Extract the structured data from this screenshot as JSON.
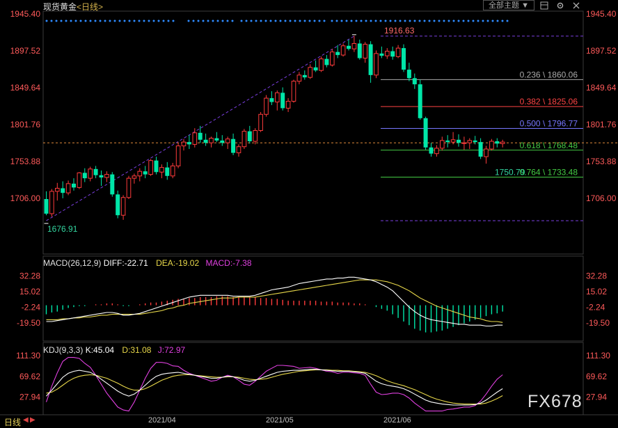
{
  "header": {
    "instrument": "现货黄金",
    "period": "<日线>",
    "theme_button": "全部主题",
    "theme_arrow": "▼"
  },
  "icons": {
    "layout": "layout-icon",
    "settings": "gear-icon",
    "close": "close-icon"
  },
  "colors": {
    "up": "#ff3b3b",
    "down": "#00e6a8",
    "bg": "#000000",
    "axis_text": "#ff5a5a",
    "dif": "#ffffff",
    "dea": "#e8d84a",
    "kdj_k": "#ffffff",
    "kdj_d": "#e8d84a",
    "kdj_j": "#e040e0",
    "fib_red": "#ff4444",
    "fib_blue": "#7777ff",
    "fib_green": "#44cc44",
    "fib_gray": "#aaaaaa"
  },
  "chart_data": [
    {
      "type": "candlestick",
      "title": "现货黄金",
      "period": "日线",
      "y_ticks": [
        "1945.40",
        "1897.52",
        "1849.64",
        "1801.76",
        "1753.88",
        "1706.00"
      ],
      "ylim": [
        1658,
        1945.4
      ],
      "x_ticks": [
        "2021/04",
        "2021/05",
        "2021/06"
      ],
      "annotations": {
        "low_label": "1676.91",
        "high_label": "1916.63",
        "swing_low_label": "1750.79"
      },
      "current_price": 1778,
      "fibonacci": [
        {
          "label": "0.236 \\ 1860.06",
          "value": 1860.06,
          "color": "gray"
        },
        {
          "label": "0.382 \\ 1825.06",
          "value": 1825.06,
          "color": "red"
        },
        {
          "label": "0.500 \\ 1796.77",
          "value": 1796.77,
          "color": "blue"
        },
        {
          "label": "0.618 \\ 1768.48",
          "value": 1768.48,
          "color": "green"
        },
        {
          "label": "0.764 \\ 1733.48",
          "value": 1733.48,
          "color": "green"
        }
      ],
      "fib_top": 1916.63,
      "fib_bottom": 1676.91,
      "ohlc": [
        [
          1705,
          1715,
          1684,
          1686
        ],
        [
          1686,
          1718,
          1682,
          1715
        ],
        [
          1715,
          1726,
          1703,
          1719
        ],
        [
          1719,
          1728,
          1706,
          1713
        ],
        [
          1713,
          1729,
          1710,
          1725
        ],
        [
          1725,
          1732,
          1716,
          1720
        ],
        [
          1720,
          1740,
          1718,
          1739
        ],
        [
          1739,
          1745,
          1727,
          1732
        ],
        [
          1732,
          1747,
          1728,
          1744
        ],
        [
          1744,
          1748,
          1732,
          1736
        ],
        [
          1736,
          1742,
          1722,
          1733
        ],
        [
          1733,
          1741,
          1727,
          1737
        ],
        [
          1737,
          1740,
          1708,
          1711
        ],
        [
          1711,
          1716,
          1680,
          1684
        ],
        [
          1684,
          1710,
          1678,
          1707
        ],
        [
          1707,
          1735,
          1705,
          1732
        ],
        [
          1732,
          1738,
          1725,
          1735
        ],
        [
          1735,
          1745,
          1728,
          1741
        ],
        [
          1741,
          1748,
          1732,
          1737
        ],
        [
          1737,
          1757,
          1735,
          1755
        ],
        [
          1755,
          1760,
          1737,
          1740
        ],
        [
          1740,
          1750,
          1732,
          1746
        ],
        [
          1746,
          1753,
          1730,
          1735
        ],
        [
          1735,
          1752,
          1732,
          1748
        ],
        [
          1748,
          1778,
          1745,
          1774
        ],
        [
          1774,
          1783,
          1768,
          1779
        ],
        [
          1779,
          1788,
          1770,
          1776
        ],
        [
          1776,
          1797,
          1772,
          1791
        ],
        [
          1791,
          1800,
          1778,
          1782
        ],
        [
          1782,
          1790,
          1774,
          1778
        ],
        [
          1778,
          1786,
          1772,
          1784
        ],
        [
          1784,
          1792,
          1779,
          1781
        ],
        [
          1781,
          1788,
          1774,
          1778
        ],
        [
          1778,
          1786,
          1770,
          1783
        ],
        [
          1783,
          1790,
          1762,
          1765
        ],
        [
          1765,
          1776,
          1760,
          1773
        ],
        [
          1773,
          1796,
          1770,
          1793
        ],
        [
          1793,
          1800,
          1777,
          1780
        ],
        [
          1780,
          1797,
          1776,
          1794
        ],
        [
          1794,
          1818,
          1792,
          1815
        ],
        [
          1815,
          1840,
          1812,
          1836
        ],
        [
          1836,
          1845,
          1827,
          1831
        ],
        [
          1831,
          1846,
          1820,
          1843
        ],
        [
          1843,
          1850,
          1820,
          1823
        ],
        [
          1823,
          1836,
          1818,
          1832
        ],
        [
          1832,
          1860,
          1830,
          1858
        ],
        [
          1858,
          1870,
          1854,
          1866
        ],
        [
          1866,
          1872,
          1860,
          1863
        ],
        [
          1863,
          1880,
          1861,
          1876
        ],
        [
          1876,
          1885,
          1870,
          1872
        ],
        [
          1872,
          1890,
          1870,
          1887
        ],
        [
          1887,
          1892,
          1876,
          1879
        ],
        [
          1879,
          1900,
          1877,
          1896
        ],
        [
          1896,
          1905,
          1888,
          1892
        ],
        [
          1892,
          1907,
          1890,
          1904
        ],
        [
          1904,
          1912,
          1898,
          1900
        ],
        [
          1900,
          1917,
          1896,
          1907
        ],
        [
          1907,
          1912,
          1886,
          1888
        ],
        [
          1888,
          1909,
          1882,
          1906
        ],
        [
          1906,
          1910,
          1856,
          1866
        ],
        [
          1866,
          1898,
          1862,
          1894
        ],
        [
          1894,
          1903,
          1888,
          1891
        ],
        [
          1891,
          1901,
          1887,
          1897
        ],
        [
          1897,
          1903,
          1886,
          1890
        ],
        [
          1890,
          1905,
          1888,
          1901
        ],
        [
          1901,
          1906,
          1870,
          1873
        ],
        [
          1873,
          1882,
          1858,
          1862
        ],
        [
          1862,
          1868,
          1848,
          1854
        ],
        [
          1854,
          1860,
          1808,
          1810
        ],
        [
          1810,
          1812,
          1769,
          1772
        ],
        [
          1772,
          1778,
          1760,
          1764
        ],
        [
          1764,
          1775,
          1760,
          1771
        ],
        [
          1771,
          1786,
          1768,
          1781
        ],
        [
          1781,
          1788,
          1772,
          1779
        ],
        [
          1779,
          1792,
          1776,
          1782
        ],
        [
          1782,
          1789,
          1773,
          1778
        ],
        [
          1778,
          1786,
          1769,
          1778
        ],
        [
          1778,
          1784,
          1770,
          1781
        ],
        [
          1781,
          1787,
          1776,
          1779
        ],
        [
          1779,
          1784,
          1757,
          1760
        ],
        [
          1760,
          1774,
          1751,
          1770
        ],
        [
          1770,
          1783,
          1768,
          1780
        ],
        [
          1780,
          1784,
          1772,
          1777
        ],
        [
          1777,
          1782,
          1772,
          1779
        ]
      ]
    },
    {
      "type": "bar+line",
      "title": "MACD(26,12,9)",
      "legend": {
        "dif": "DIFF:-22.71",
        "dea": "DEA:-19.02",
        "macd": "MACD:-7.38"
      },
      "y_ticks": [
        "32.28",
        "15.02",
        "-2.24",
        "-19.50"
      ],
      "ylim": [
        -38,
        42
      ],
      "macd": [
        -10,
        -8,
        -7,
        -5,
        -3,
        -2,
        -1,
        -1,
        0,
        1,
        1,
        2,
        2,
        1,
        -1,
        -1,
        0,
        1,
        2,
        3,
        3,
        4,
        5,
        6,
        7,
        7,
        8,
        8,
        9,
        9,
        9,
        10,
        10,
        10,
        9,
        9,
        9,
        9,
        9,
        8,
        8,
        7,
        7,
        6,
        5,
        5,
        5,
        5,
        5,
        5,
        4,
        4,
        4,
        3,
        3,
        3,
        2,
        2,
        1,
        0,
        -2,
        -4,
        -6,
        -10,
        -14,
        -18,
        -22,
        -26,
        -28,
        -30,
        -30,
        -29,
        -28,
        -26,
        -24,
        -22,
        -20,
        -18,
        -16,
        -14,
        -12,
        -10,
        -9,
        -7
      ],
      "dif": [
        -18,
        -18,
        -17,
        -16,
        -15,
        -14,
        -13,
        -12,
        -11,
        -10,
        -9,
        -8,
        -8,
        -9,
        -11,
        -11,
        -10,
        -9,
        -7,
        -5,
        -3,
        -1,
        1,
        3,
        5,
        7,
        9,
        10,
        11,
        11,
        11,
        11,
        11,
        11,
        10,
        10,
        10,
        10,
        11,
        13,
        15,
        17,
        18,
        19,
        20,
        22,
        24,
        25,
        26,
        27,
        28,
        29,
        29,
        30,
        30,
        31,
        31,
        30,
        29,
        28,
        26,
        23,
        20,
        16,
        10,
        4,
        -2,
        -7,
        -11,
        -14,
        -16,
        -17,
        -18,
        -19,
        -20,
        -21,
        -21,
        -22,
        -22,
        -22,
        -23,
        -23,
        -22,
        -22
      ],
      "dea": [
        -16,
        -16,
        -16,
        -15,
        -15,
        -14,
        -14,
        -13,
        -13,
        -12,
        -11,
        -11,
        -10,
        -10,
        -10,
        -10,
        -10,
        -10,
        -9,
        -8,
        -7,
        -6,
        -4,
        -3,
        -1,
        0,
        2,
        3,
        4,
        5,
        6,
        7,
        8,
        8,
        8,
        9,
        9,
        9,
        9,
        10,
        11,
        12,
        13,
        14,
        15,
        16,
        17,
        18,
        19,
        20,
        21,
        22,
        23,
        24,
        25,
        26,
        27,
        28,
        28,
        28,
        28,
        27,
        26,
        24,
        22,
        19,
        16,
        12,
        8,
        5,
        2,
        -1,
        -3,
        -5,
        -7,
        -9,
        -11,
        -13,
        -14,
        -15,
        -17,
        -18,
        -18,
        -19
      ]
    },
    {
      "type": "line",
      "title": "KDJ(9,3,3)",
      "legend": {
        "k": "K:45.04",
        "d": "D:31.08",
        "j": "J:72.97"
      },
      "y_ticks": [
        "111.30",
        "69.62",
        "27.94"
      ],
      "ylim": [
        -2,
        120
      ],
      "k": [
        30,
        42,
        55,
        68,
        76,
        80,
        82,
        80,
        78,
        72,
        64,
        56,
        48,
        40,
        34,
        30,
        34,
        42,
        52,
        62,
        70,
        74,
        76,
        77,
        78,
        76,
        74,
        72,
        70,
        68,
        66,
        66,
        68,
        70,
        69,
        66,
        62,
        60,
        62,
        66,
        70,
        74,
        78,
        80,
        81,
        82,
        82,
        83,
        84,
        84,
        83,
        82,
        81,
        80,
        80,
        80,
        79,
        78,
        76,
        68,
        60,
        55,
        52,
        50,
        48,
        45,
        40,
        34,
        28,
        22,
        18,
        16,
        14,
        13,
        12,
        12,
        12,
        12,
        13,
        16,
        22,
        30,
        38,
        45
      ],
      "d": [
        36,
        38,
        44,
        52,
        60,
        66,
        70,
        72,
        73,
        72,
        69,
        66,
        61,
        56,
        50,
        45,
        42,
        42,
        45,
        50,
        56,
        62,
        66,
        70,
        72,
        73,
        73,
        72,
        71,
        70,
        69,
        68,
        68,
        69,
        69,
        68,
        66,
        64,
        63,
        64,
        65,
        68,
        71,
        74,
        76,
        78,
        80,
        81,
        82,
        83,
        83,
        83,
        82,
        82,
        81,
        81,
        80,
        79,
        78,
        75,
        71,
        66,
        61,
        57,
        54,
        51,
        47,
        43,
        38,
        33,
        28,
        24,
        21,
        18,
        16,
        15,
        14,
        14,
        14,
        14,
        16,
        20,
        25,
        31
      ],
      "j": [
        18,
        50,
        77,
        100,
        108,
        108,
        106,
        96,
        88,
        72,
        54,
        36,
        22,
        8,
        2,
        0,
        18,
        42,
        66,
        86,
        98,
        98,
        96,
        91,
        90,
        82,
        76,
        72,
        68,
        64,
        60,
        62,
        68,
        72,
        69,
        62,
        54,
        52,
        60,
        70,
        80,
        86,
        92,
        92,
        91,
        90,
        86,
        87,
        88,
        86,
        83,
        80,
        79,
        76,
        78,
        78,
        77,
        76,
        72,
        54,
        38,
        33,
        34,
        36,
        36,
        33,
        26,
        16,
        8,
        0,
        0,
        0,
        0,
        3,
        4,
        6,
        8,
        8,
        11,
        20,
        34,
        50,
        64,
        73
      ]
    }
  ]
}
